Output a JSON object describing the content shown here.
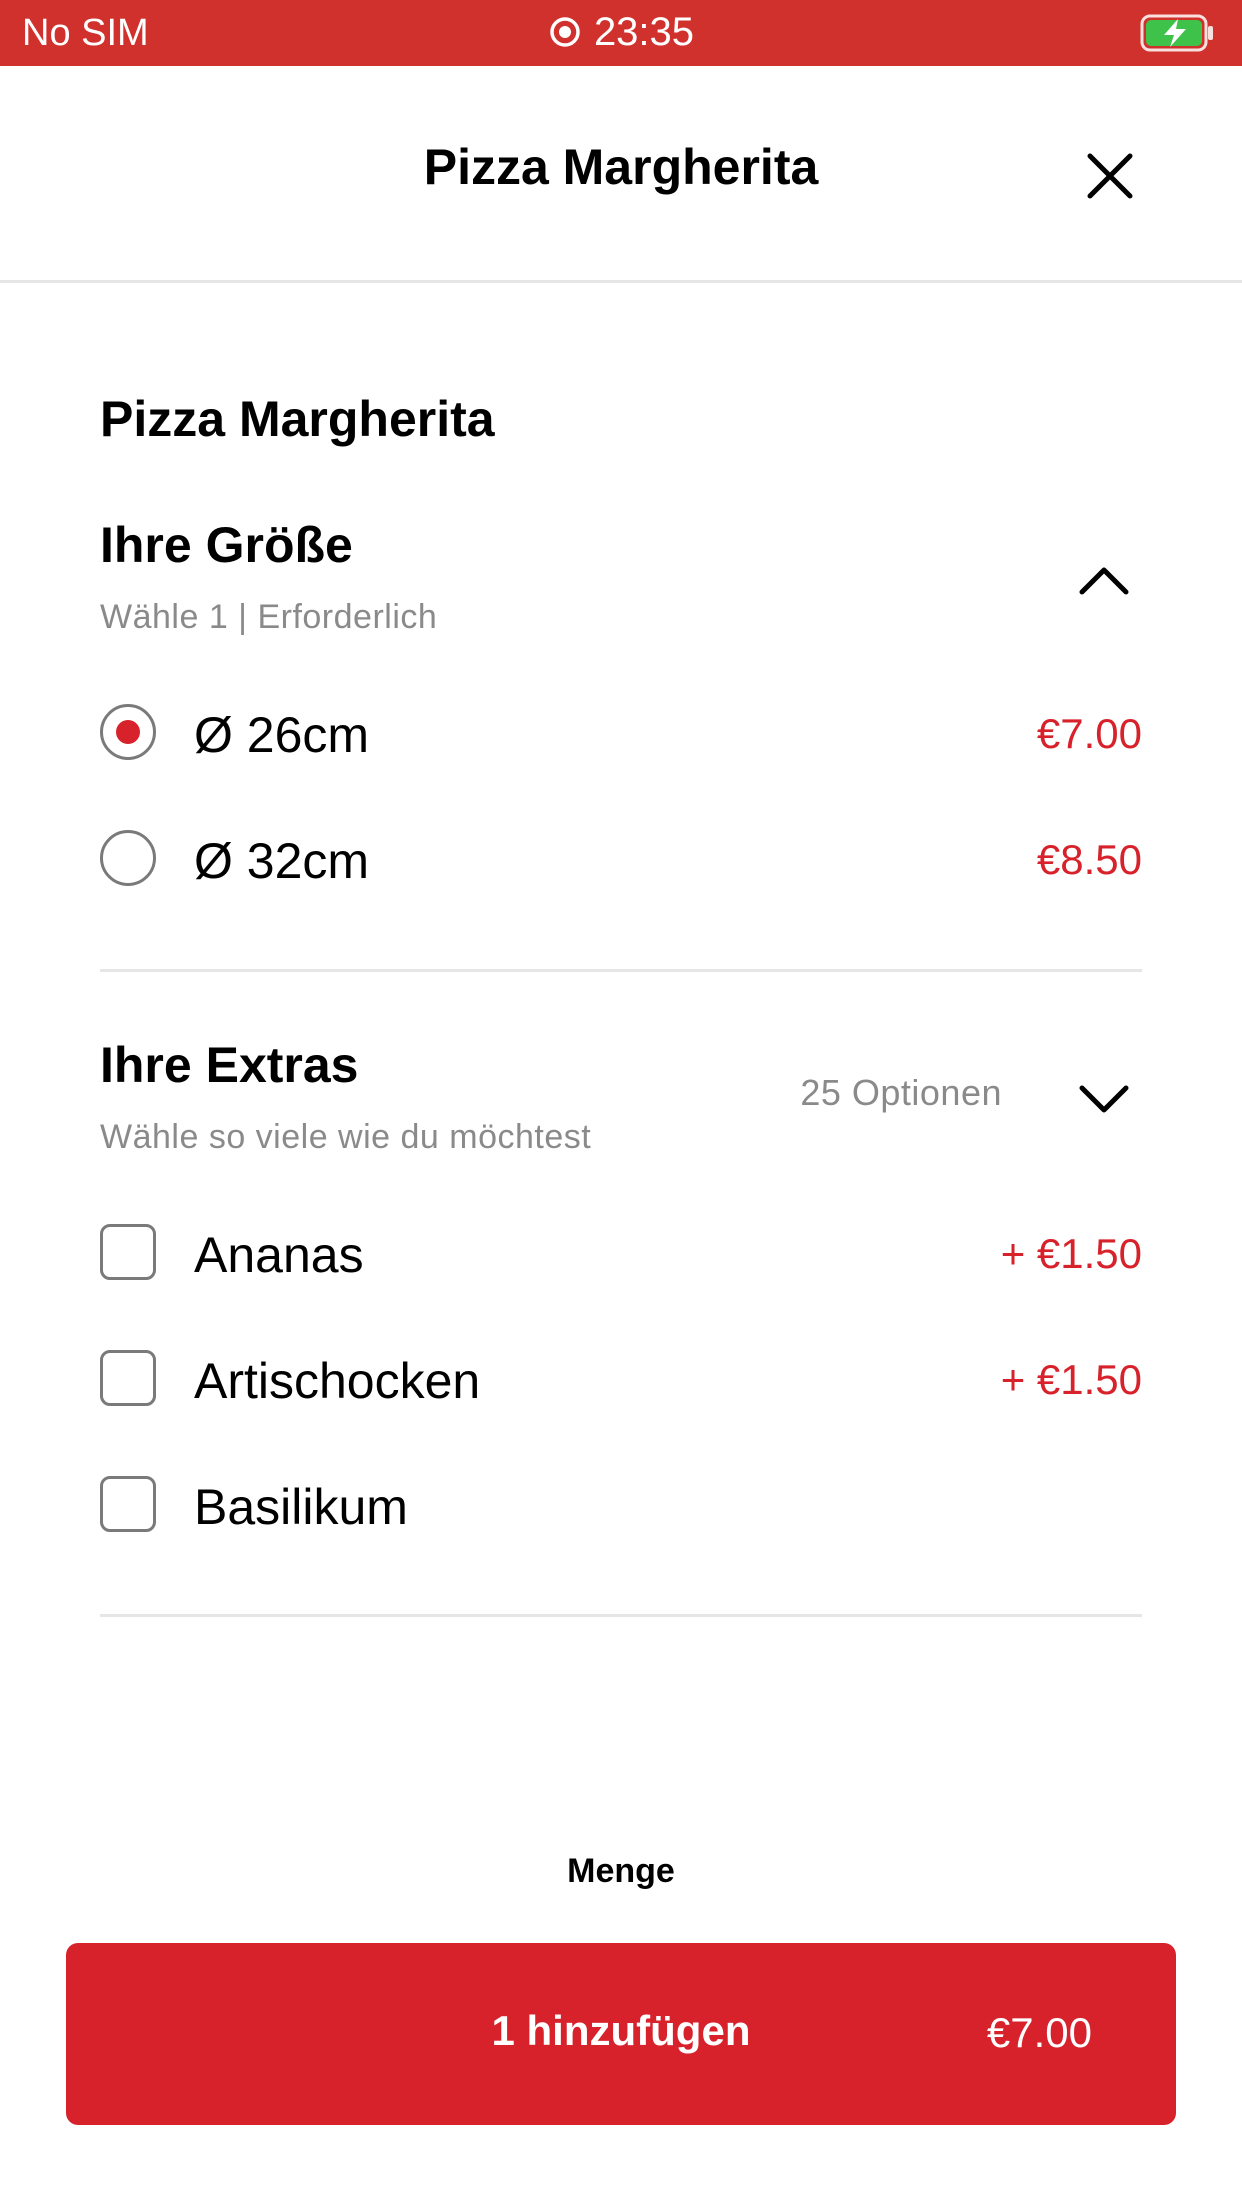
{
  "status_bar": {
    "carrier": "No SIM",
    "time": "23:35",
    "background_color": "#d0312d"
  },
  "header": {
    "title": "Pizza Margherita",
    "close_icon": "close-icon"
  },
  "item": {
    "title": "Pizza Margherita"
  },
  "size_section": {
    "title": "Ihre Größe",
    "subtitle": "Wähle 1  |  Erforderlich",
    "expanded": true,
    "options": [
      {
        "label": "Ø 26cm",
        "price": "€7.00",
        "selected": true
      },
      {
        "label": "Ø 32cm",
        "price": "€8.50",
        "selected": false
      }
    ]
  },
  "extras_section": {
    "title": "Ihre Extras",
    "subtitle": "Wähle so viele wie du möchtest",
    "options_count": "25 Optionen",
    "expanded": false,
    "options": [
      {
        "label": "Ananas",
        "price": "+ €1.50",
        "checked": false
      },
      {
        "label": "Artischocken",
        "price": "+ €1.50",
        "checked": false
      },
      {
        "label": "Basilikum",
        "price": "",
        "checked": false
      }
    ]
  },
  "quantity": {
    "label": "Menge"
  },
  "add_button": {
    "label": "1 hinzufügen",
    "price": "€7.00"
  },
  "colors": {
    "accent": "#d7222c",
    "muted_text": "#8a8a8a",
    "divider": "#e6e6e6"
  }
}
